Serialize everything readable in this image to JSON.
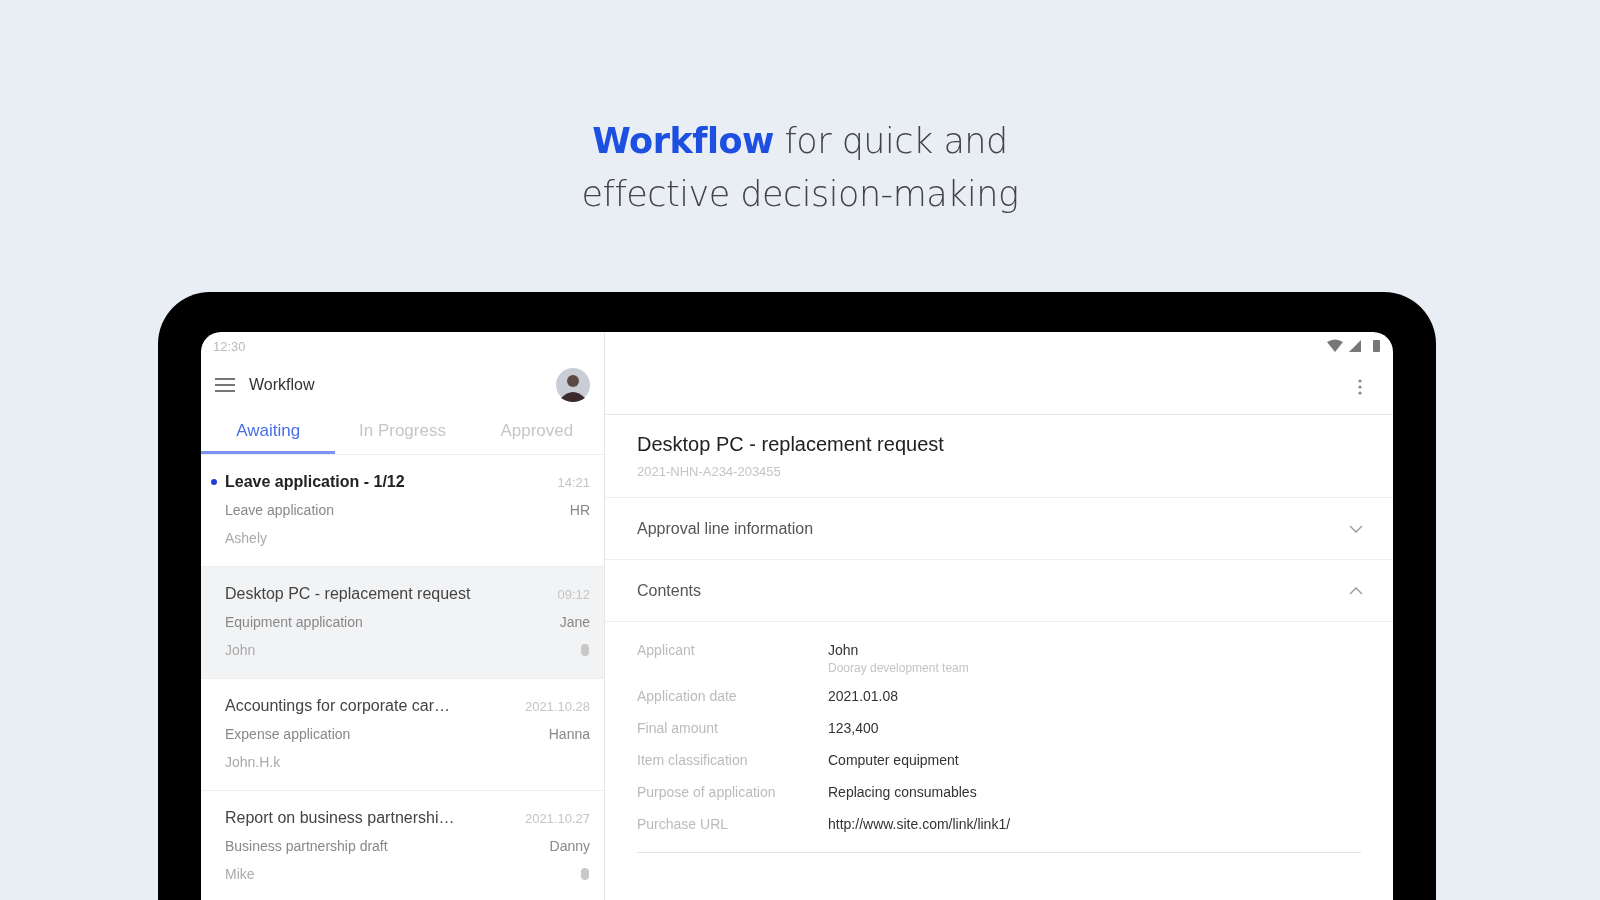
{
  "headline": [
    "**Workflow** for quick and",
    "effective decision-making"
  ],
  "status_bar": {
    "time": "12:30"
  },
  "app_bar": {
    "title": "Workflow"
  },
  "tabs": [
    {
      "label": "Awaiting",
      "selected": true
    },
    {
      "label": "In Progress",
      "selected": false
    },
    {
      "label": "Approved",
      "selected": false
    }
  ],
  "items": [
    {
      "title": "Leave application - 1/12",
      "time": "14:21",
      "category": "Leave application",
      "team": "HR",
      "author": "Ashely",
      "unread": true,
      "selected": false,
      "attachment": false
    },
    {
      "title": "Desktop PC - replacement request",
      "time": "09:12",
      "category": "Equipment application",
      "team": "Jane",
      "author": "John",
      "unread": false,
      "selected": true,
      "attachment": true
    },
    {
      "title": "Accountings for corporate car…",
      "time": "2021.10.28",
      "category": "Expense application",
      "team": "Hanna",
      "author": "John.H.k",
      "unread": false,
      "selected": false,
      "attachment": false
    },
    {
      "title": "Report on business partnershi…",
      "time": "2021.10.27",
      "category": "Business partnership draft",
      "team": "Danny",
      "author": "Mike",
      "unread": false,
      "selected": false,
      "attachment": true
    }
  ],
  "detail": {
    "title": "Desktop PC - replacement request",
    "doc_number": "2021-NHN-A234-203455",
    "sections": [
      {
        "label": "Approval line information",
        "expanded": false
      },
      {
        "label": "Contents",
        "expanded": true
      }
    ],
    "fields": [
      {
        "label": "Applicant",
        "value": "John",
        "sub": "Dooray development team"
      },
      {
        "label": "Application date",
        "value": "2021.01.08"
      },
      {
        "label": "Final amount",
        "value": "123,400"
      },
      {
        "label": "Item classification",
        "value": "Computer equipment"
      },
      {
        "label": "Purpose of application",
        "value": "Replacing consumables"
      },
      {
        "label": "Purchase URL",
        "value": "http://www.site.com/link/link1/"
      }
    ]
  }
}
